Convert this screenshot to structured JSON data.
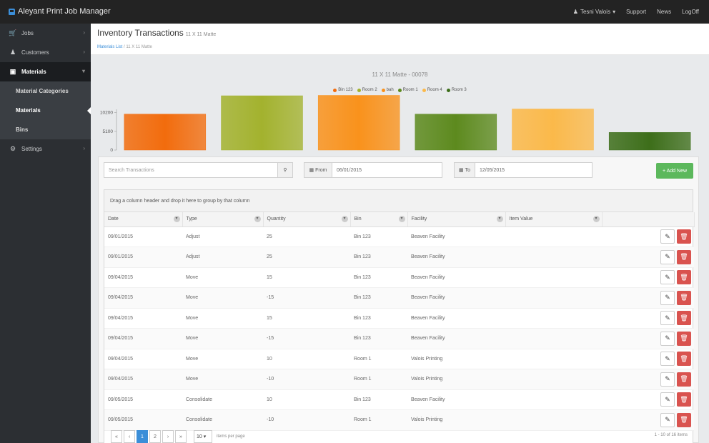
{
  "app": {
    "title": "Aleyant Print Job Manager",
    "nav": {
      "user": "Tesni Valois",
      "support": "Support",
      "news": "News",
      "logoff": "LogOff"
    }
  },
  "sidebar": {
    "items": [
      {
        "label": "Jobs",
        "icon": "cart-icon"
      },
      {
        "label": "Customers",
        "icon": "users-icon"
      },
      {
        "label": "Materials",
        "icon": "box-icon"
      },
      {
        "label": "Settings",
        "icon": "gear-icon"
      }
    ],
    "sub": [
      "Material Categories",
      "Materials",
      "Bins"
    ]
  },
  "page": {
    "title": "Inventory Transactions",
    "subtitle": "11 X 11 Matte",
    "breadcrumb": {
      "link": "Materials List",
      "sep": "/",
      "current": "11 X 11 Matte"
    }
  },
  "chart_data": {
    "type": "bar",
    "title": "11 X 11 Matte - 00078",
    "series": [
      {
        "name": "Bin 123",
        "value": 9800,
        "color": "#f26c0d"
      },
      {
        "name": "Room 2",
        "value": 14800,
        "color": "#a3b22e"
      },
      {
        "name": "bah",
        "value": 14900,
        "color": "#f9921c"
      },
      {
        "name": "Room 1",
        "value": 9800,
        "color": "#5d8a1e"
      },
      {
        "name": "Room 4",
        "value": 11200,
        "color": "#fbb94a"
      },
      {
        "name": "Room 3",
        "value": 4800,
        "color": "#3d6e1a"
      }
    ],
    "yticks": [
      {
        "value": 0,
        "label": "0"
      },
      {
        "value": 5100,
        "label": "5100"
      },
      {
        "value": 10200,
        "label": "10200"
      }
    ],
    "ylim": [
      0,
      15000
    ],
    "legend": "top",
    "grid": false
  },
  "toolbar": {
    "search_placeholder": "Search Transactions",
    "from_label": "From",
    "from_value": "06/01/2015",
    "to_label": "To",
    "to_value": "12/05/2015",
    "add_label": "+ Add New"
  },
  "grid": {
    "group_hint": "Drag a column header and drop it here to group by that column",
    "columns": [
      "Date",
      "Type",
      "Quantity",
      "Bin",
      "Facility",
      "Item Value"
    ],
    "rows": [
      [
        "09/01/2015",
        "Adjust",
        "25",
        "Bin 123",
        "Beaven Facility",
        ""
      ],
      [
        "09/01/2015",
        "Adjust",
        "25",
        "Bin 123",
        "Beaven Facility",
        ""
      ],
      [
        "09/04/2015",
        "Move",
        "15",
        "Bin 123",
        "Beaven Facility",
        ""
      ],
      [
        "09/04/2015",
        "Move",
        "-15",
        "Bin 123",
        "Beaven Facility",
        ""
      ],
      [
        "09/04/2015",
        "Move",
        "15",
        "Bin 123",
        "Beaven Facility",
        ""
      ],
      [
        "09/04/2015",
        "Move",
        "-15",
        "Bin 123",
        "Beaven Facility",
        ""
      ],
      [
        "09/04/2015",
        "Move",
        "10",
        "Room 1",
        "Valois Printing",
        ""
      ],
      [
        "09/04/2015",
        "Move",
        "-10",
        "Room 1",
        "Valois Printing",
        ""
      ],
      [
        "09/05/2015",
        "Consolidate",
        "10",
        "Bin 123",
        "Beaven Facility",
        ""
      ],
      [
        "09/05/2015",
        "Consolidate",
        "-10",
        "Room 1",
        "Valois Printing",
        ""
      ]
    ]
  },
  "pager": {
    "pages": [
      "«",
      "‹",
      "1",
      "2",
      "›",
      "»"
    ],
    "current": "1",
    "page_size": "10",
    "page_size_label": "items per page",
    "info": "1 - 10 of 16 items"
  }
}
